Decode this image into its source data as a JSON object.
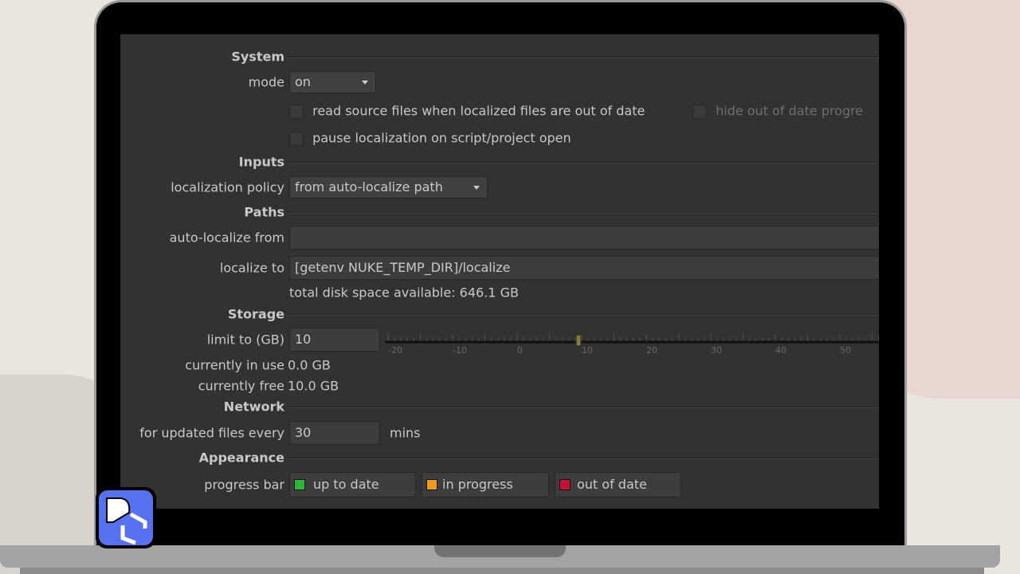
{
  "system": {
    "header": "System",
    "mode_label": "mode",
    "mode_value": "on",
    "read_source_label": "read source files when localized files are out of date",
    "hide_progress_label": "hide out of date progre",
    "pause_label": "pause localization on script/project open"
  },
  "inputs": {
    "header": "Inputs",
    "policy_label": "localization policy",
    "policy_value": "from auto-localize path"
  },
  "paths": {
    "header": "Paths",
    "auto_from_label": "auto-localize from",
    "auto_from_value": "",
    "localize_to_label": "localize to",
    "localize_to_value": "[getenv NUKE_TEMP_DIR]/localize",
    "disk_space": "total disk space available: 646.1 GB"
  },
  "storage": {
    "header": "Storage",
    "limit_label": "limit to (GB)",
    "limit_value": "10",
    "slider_value": 10,
    "slider_ticks": [
      "-20",
      "-10",
      "0",
      "10",
      "20",
      "30",
      "40",
      "50"
    ],
    "in_use_label": "currently in use",
    "in_use_value": "0.0 GB",
    "free_label": "currently free",
    "free_value": "10.0 GB"
  },
  "network": {
    "header": "Network",
    "updated_label": "for updated files every",
    "updated_value": "30",
    "unit": "mins"
  },
  "appearance": {
    "header": "Appearance",
    "progress_label": "progress bar",
    "buttons": [
      {
        "label": "up to date",
        "color": "#2db53c"
      },
      {
        "label": "in progress",
        "color": "#f29a1e"
      },
      {
        "label": "out of date",
        "color": "#c8102e"
      }
    ]
  }
}
